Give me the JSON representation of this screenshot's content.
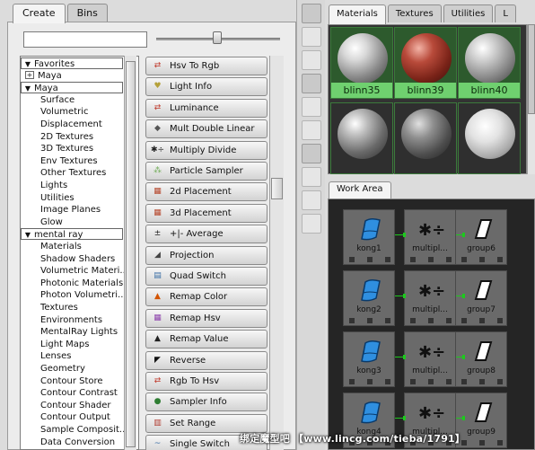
{
  "left_tabs": [
    {
      "label": "Create",
      "active": true
    },
    {
      "label": "Bins",
      "active": false
    }
  ],
  "search": {
    "value": ""
  },
  "icon_size_slider": {
    "value_fraction": 0.46
  },
  "tree": [
    {
      "label": "Favorites",
      "type": "header",
      "expanded": true,
      "indent": 0
    },
    {
      "label": "Maya",
      "type": "collapsed",
      "indent": 1
    },
    {
      "label": "Maya",
      "type": "header",
      "expanded": true,
      "indent": 0
    },
    {
      "label": "Surface",
      "type": "item",
      "indent": 2
    },
    {
      "label": "Volumetric",
      "type": "item",
      "indent": 2
    },
    {
      "label": "Displacement",
      "type": "item",
      "indent": 2
    },
    {
      "label": "2D Textures",
      "type": "item",
      "indent": 2
    },
    {
      "label": "3D Textures",
      "type": "item",
      "indent": 2
    },
    {
      "label": "Env Textures",
      "type": "item",
      "indent": 2
    },
    {
      "label": "Other Textures",
      "type": "item",
      "indent": 2
    },
    {
      "label": "Lights",
      "type": "item",
      "indent": 2
    },
    {
      "label": "Utilities",
      "type": "item",
      "indent": 2
    },
    {
      "label": "Image Planes",
      "type": "item",
      "indent": 2
    },
    {
      "label": "Glow",
      "type": "item",
      "indent": 2
    },
    {
      "label": "mental ray",
      "type": "header",
      "expanded": true,
      "indent": 0
    },
    {
      "label": "Materials",
      "type": "item",
      "indent": 2
    },
    {
      "label": "Shadow Shaders",
      "type": "item",
      "indent": 2
    },
    {
      "label": "Volumetric Materi...",
      "type": "item",
      "indent": 2
    },
    {
      "label": "Photonic Materials",
      "type": "item",
      "indent": 2
    },
    {
      "label": "Photon Volumetri...",
      "type": "item",
      "indent": 2
    },
    {
      "label": "Textures",
      "type": "item",
      "indent": 2
    },
    {
      "label": "Environments",
      "type": "item",
      "indent": 2
    },
    {
      "label": "MentalRay Lights",
      "type": "item",
      "indent": 2
    },
    {
      "label": "Light Maps",
      "type": "item",
      "indent": 2
    },
    {
      "label": "Lenses",
      "type": "item",
      "indent": 2
    },
    {
      "label": "Geometry",
      "type": "item",
      "indent": 2
    },
    {
      "label": "Contour Store",
      "type": "item",
      "indent": 2
    },
    {
      "label": "Contour Contrast",
      "type": "item",
      "indent": 2
    },
    {
      "label": "Contour Shader",
      "type": "item",
      "indent": 2
    },
    {
      "label": "Contour Output",
      "type": "item",
      "indent": 2
    },
    {
      "label": "Sample Composit...",
      "type": "item",
      "indent": 2
    },
    {
      "label": "Data Conversion",
      "type": "item",
      "indent": 2
    }
  ],
  "node_buttons": [
    {
      "label": "Hsv To Rgb",
      "icon": "hsv-to-rgb-icon",
      "glyph": "⇄",
      "color": "#c0392b"
    },
    {
      "label": "Light Info",
      "icon": "light-info-icon",
      "glyph": "♥",
      "color": "#b5a13a"
    },
    {
      "label": "Luminance",
      "icon": "luminance-icon",
      "glyph": "⇄",
      "color": "#c0392b"
    },
    {
      "label": "Mult Double Linear",
      "icon": "mult-double-linear-icon",
      "glyph": "◆",
      "color": "#555555"
    },
    {
      "label": "Multiply Divide",
      "icon": "multiply-divide-icon",
      "glyph": "✱÷",
      "color": "#222222"
    },
    {
      "label": "Particle Sampler",
      "icon": "particle-sampler-icon",
      "glyph": "⁂",
      "color": "#6aa84f"
    },
    {
      "label": "2d Placement",
      "icon": "2d-placement-icon",
      "glyph": "▦",
      "color": "#b5462b"
    },
    {
      "label": "3d Placement",
      "icon": "3d-placement-icon",
      "glyph": "▦",
      "color": "#b5462b"
    },
    {
      "label": "+|- Average",
      "icon": "plus-minus-average-icon",
      "glyph": "±",
      "color": "#222222"
    },
    {
      "label": "Projection",
      "icon": "projection-icon",
      "glyph": "◢",
      "color": "#444444"
    },
    {
      "label": "Quad Switch",
      "icon": "quad-switch-icon",
      "glyph": "▤",
      "color": "#3a6ea5"
    },
    {
      "label": "Remap Color",
      "icon": "remap-color-icon",
      "glyph": "▲",
      "color": "#d35400"
    },
    {
      "label": "Remap Hsv",
      "icon": "remap-hsv-icon",
      "glyph": "▦",
      "color": "#8e44ad"
    },
    {
      "label": "Remap Value",
      "icon": "remap-value-icon",
      "glyph": "▲",
      "color": "#222222"
    },
    {
      "label": "Reverse",
      "icon": "reverse-icon",
      "glyph": "◤",
      "color": "#111111"
    },
    {
      "label": "Rgb To Hsv",
      "icon": "rgb-to-hsv-icon",
      "glyph": "⇄",
      "color": "#c0392b"
    },
    {
      "label": "Sampler Info",
      "icon": "sampler-info-icon",
      "glyph": "●",
      "color": "#2e7d32"
    },
    {
      "label": "Set Range",
      "icon": "set-range-icon",
      "glyph": "▥",
      "color": "#b03a2e"
    },
    {
      "label": "Single Switch",
      "icon": "single-switch-icon",
      "glyph": "~",
      "color": "#3a6ea5"
    }
  ],
  "right_tabs": [
    {
      "label": "Materials",
      "active": true
    },
    {
      "label": "Textures",
      "active": false
    },
    {
      "label": "Utilities",
      "active": false
    },
    {
      "label": "L",
      "active": false
    }
  ],
  "swatches": [
    {
      "label": "blinn35",
      "ball": "radial-gradient(circle at 35% 30%, #ffffff 0%, #d8d8d8 25%, #8a8a8a 60%, #3a3a3a 100%)"
    },
    {
      "label": "blinn39",
      "ball": "radial-gradient(circle at 35% 30%, #f3b3a6 0%, #b84a3a 30%, #7a2318 65%, #3a0f0a 100%)"
    },
    {
      "label": "blinn40",
      "ball": "radial-gradient(circle at 35% 30%, #ffffff 0%, #d0d0d0 25%, #8c8c8c 60%, #3c3c3c 100%)"
    },
    {
      "label": "",
      "ball": "radial-gradient(circle at 35% 30%, #ffffff 0%, #bdbdbd 25%, #6b6b6b 60%, #2a2a2a 100%)"
    },
    {
      "label": "",
      "ball": "radial-gradient(circle at 35% 30%, #e0e0e0 0%, #8f8f8f 30%, #4d4d4d 65%, #1f1f1f 100%)"
    },
    {
      "label": "",
      "ball": "radial-gradient(circle at 40% 35%, #ffffff 0%, #e2e2e2 35%, #a8a8a8 70%, #5a5a5a 100%)"
    }
  ],
  "work_area": {
    "tab_label": "Work Area",
    "rows": [
      {
        "source": "kong1",
        "middle": "multipl...",
        "target": "group6"
      },
      {
        "source": "kong2",
        "middle": "multipl...",
        "target": "group7"
      },
      {
        "source": "kong3",
        "middle": "multipl...",
        "target": "group8"
      },
      {
        "source": "kong4",
        "middle": "multipl...",
        "target": "group9"
      }
    ],
    "connection_color": "#1ec81e"
  },
  "watermark": "绑定魔型吧 【www.lincg.com/tieba/1791】"
}
